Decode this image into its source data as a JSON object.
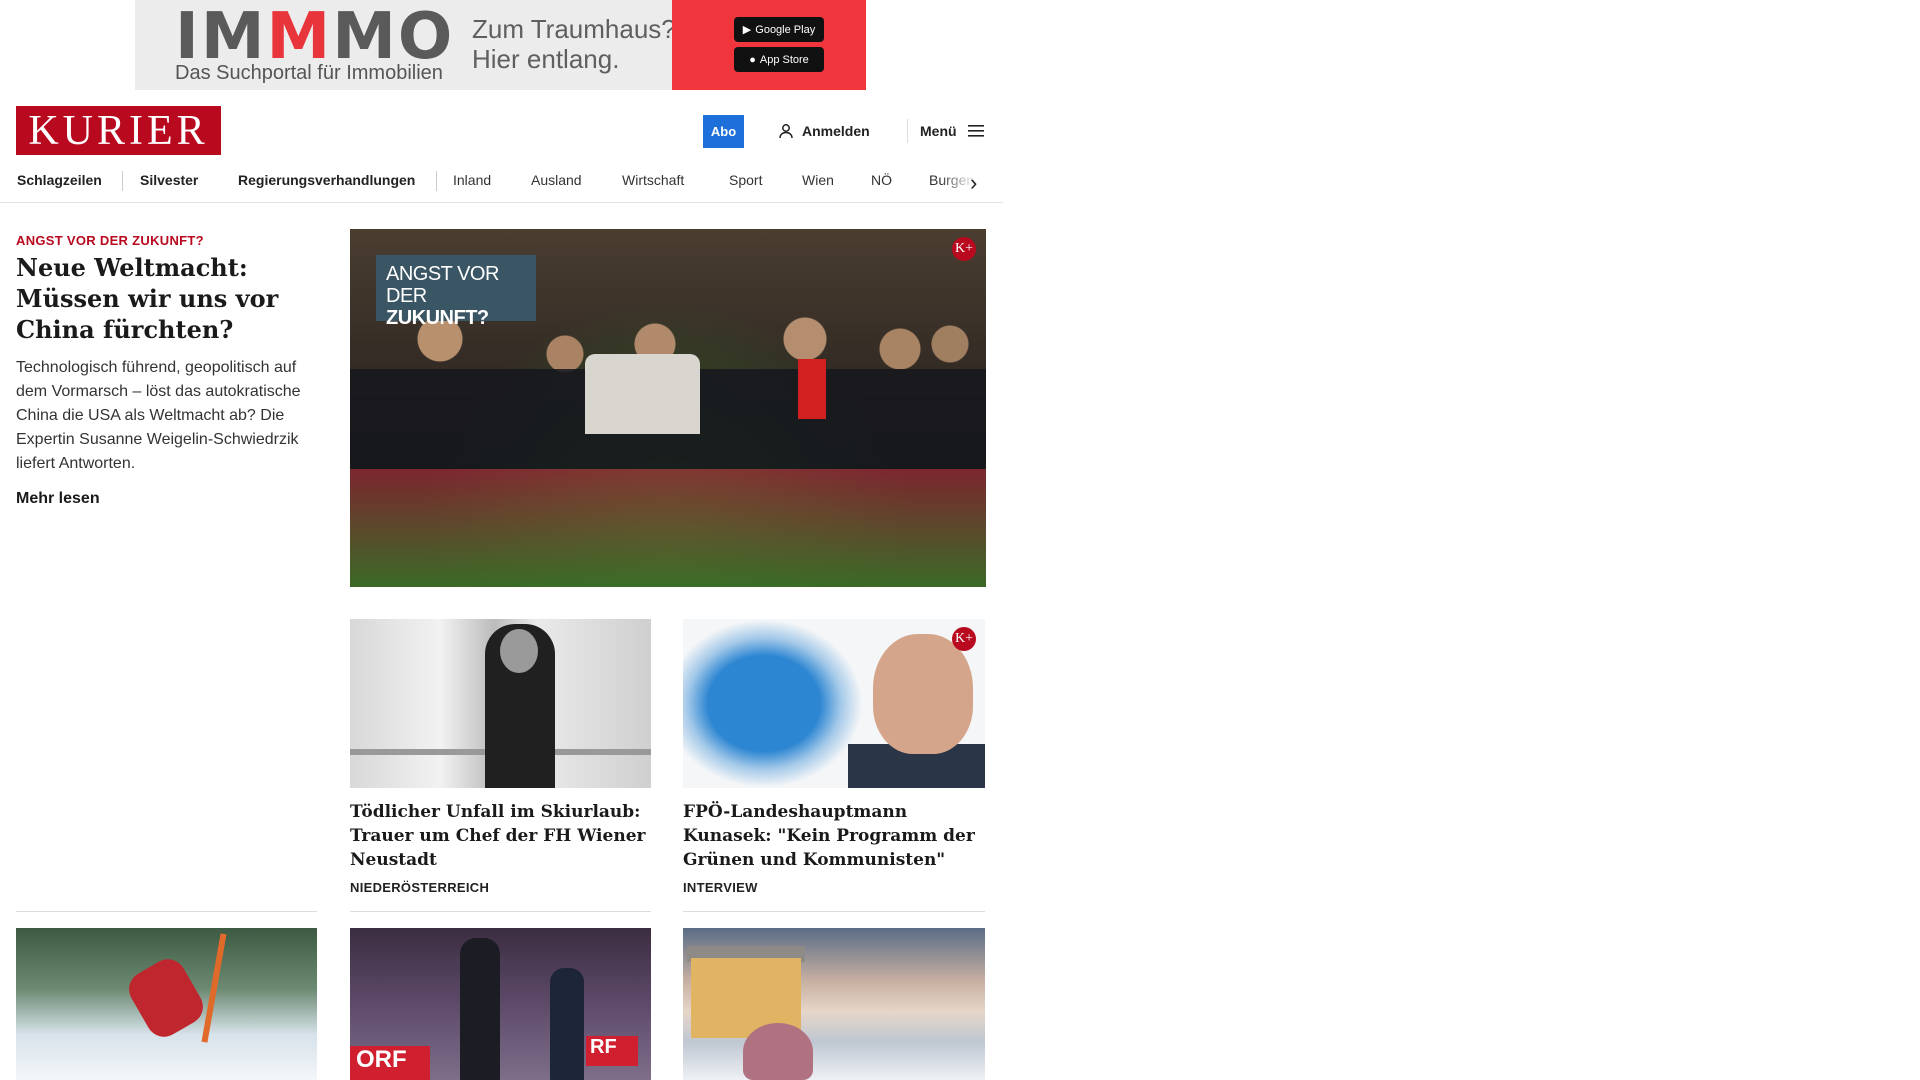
{
  "ad": {
    "brand_prefix": "IM",
    "brand_mm": "M",
    "brand_suffix": "MO",
    "subline": "Das Suchportal für Immobilien",
    "claim_line1": "Zum Traumhaus?",
    "claim_line2": "Hier entlang.",
    "google_play": "Google Play",
    "app_store": "App Store",
    "accent_color": "#f0353d"
  },
  "header": {
    "logo_text": "KURIER",
    "abo_label": "Abo",
    "login_label": "Anmelden",
    "menu_label": "Menü",
    "brand_color": "#b8091f",
    "abo_color": "#1e6fd9"
  },
  "nav": {
    "items": [
      "Schlagzeilen",
      "Silvester",
      "Regierungsverhandlungen",
      "Inland",
      "Ausland",
      "Wirtschaft",
      "Sport",
      "Wien",
      "NÖ",
      "Burgenl"
    ]
  },
  "lead": {
    "kicker": "ANGST VOR DER ZUKUNFT?",
    "title": "Neue Weltmacht: Müssen wir uns vor China fürchten?",
    "teaser": "Technologisch führend, geopolitisch auf dem Vormarsch – löst das autokratische China die USA als Weltmacht ab? Die Expertin Susanne Weigelin-Schwiedrzik liefert Antworten.",
    "more_label": "Mehr lesen",
    "image_badge_line1": "ANGST VOR DER",
    "image_badge_line2": "ZUKUNFT?",
    "plus_badge": "K+"
  },
  "cards": [
    {
      "title": "Tödlicher Unfall im Skiurlaub: Trauer um Chef der FH Wiener Neustadt",
      "label": "NIEDERÖSTERREICH"
    },
    {
      "title": "FPÖ-Landeshauptmann Kunasek: \"Kein Programm der Grünen und Kommunisten\"",
      "label": "INTERVIEW",
      "plus_badge": "K+"
    }
  ],
  "row3": {
    "orf_text_1": "ORF",
    "orf_text_2": "RF"
  }
}
